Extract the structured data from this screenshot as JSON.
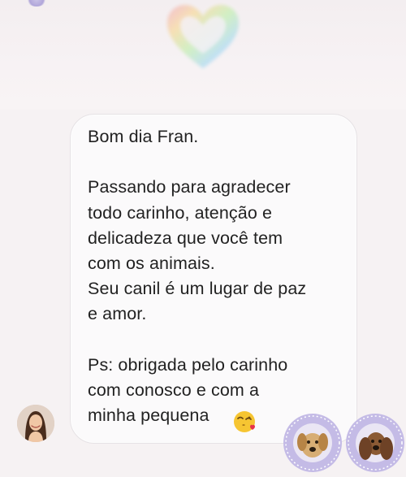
{
  "message": {
    "text": "Bom dia Fran.\n\nPassando para agradecer\ntodo carinho, atenção e\ndelicadeza que você tem\ncom os animais.\nSeu canil é um lugar de paz\ne amor.\n\nPs: obrigada pelo carinho\ncom conosco e com a\nminha pequena"
  },
  "decorations": {
    "top_sticker": "rainbow-heart-icon",
    "emoji": "face-blowing-kiss-icon",
    "avatar": "sender-avatar",
    "stickers": [
      "dog-sticker-icon",
      "spaniel-sticker-icon"
    ]
  },
  "colors": {
    "background": "#f6f2f3",
    "bubble": "#fbfafb",
    "text": "#222222",
    "sticker_frame": "#b9b0de"
  }
}
